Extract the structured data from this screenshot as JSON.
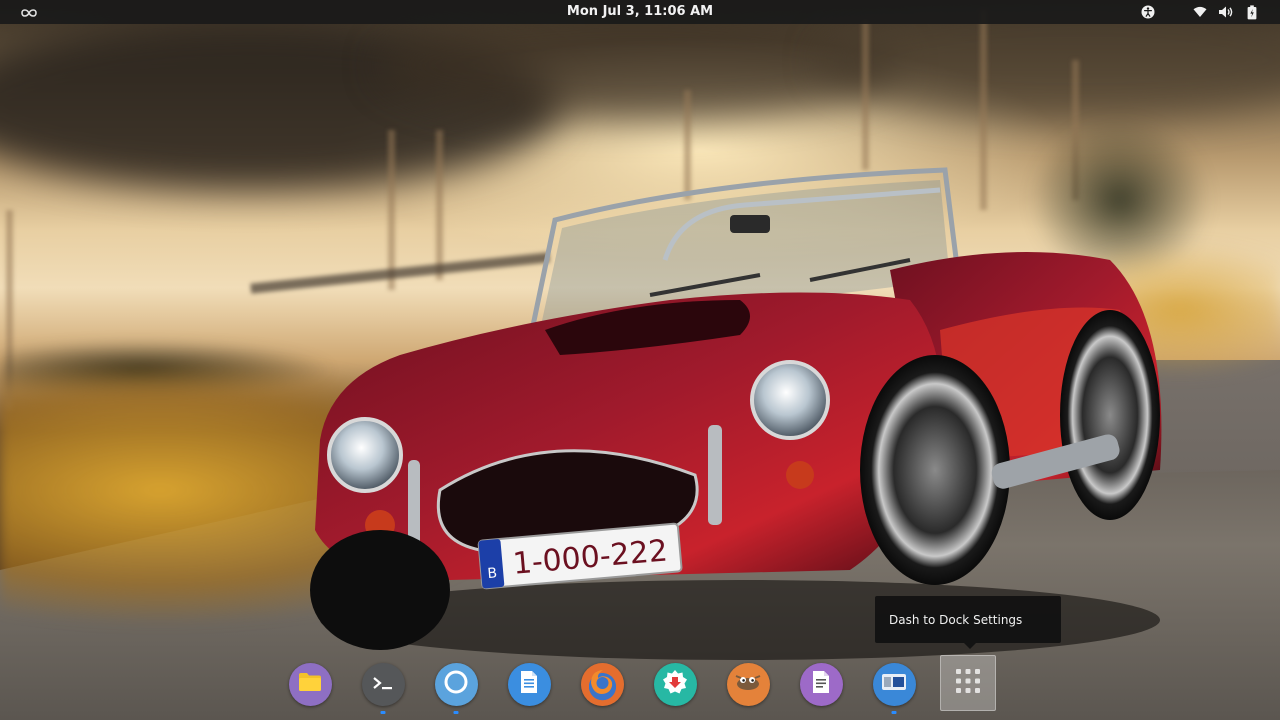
{
  "topbar": {
    "clock": "Mon Jul  3, 11:06 AM",
    "activities_icon": "infinity-icon",
    "tray_icons": [
      "accessibility-icon",
      "wifi-icon",
      "volume-icon",
      "battery-icon"
    ]
  },
  "tooltip": {
    "text": "Dash to Dock Settings"
  },
  "wallpaper": {
    "license_plate": "1-000-222",
    "plate_country": "B"
  },
  "dock": {
    "items": [
      {
        "name": "files",
        "icon": "folder-icon",
        "color": "#8e6fc3",
        "running": false
      },
      {
        "name": "terminal",
        "icon": "terminal-icon",
        "color": "#555759",
        "running": true
      },
      {
        "name": "chromium",
        "icon": "browser-icon",
        "color": "#5ba3dd",
        "running": true
      },
      {
        "name": "text-editor",
        "icon": "document-icon",
        "color": "#3b8ee0",
        "running": false
      },
      {
        "name": "firefox",
        "icon": "firefox-icon",
        "color": "#e46d2e",
        "running": false
      },
      {
        "name": "software-center",
        "icon": "software-center-icon",
        "color": "#27b8a4",
        "running": false
      },
      {
        "name": "gimp",
        "icon": "gimp-icon",
        "color": "#e4823a",
        "running": false
      },
      {
        "name": "document-viewer",
        "icon": "document-viewer-icon",
        "color": "#9d6ac8",
        "running": false
      },
      {
        "name": "system-monitor",
        "icon": "system-monitor-icon",
        "color": "#3a88d8",
        "running": true
      },
      {
        "name": "show-applications",
        "icon": "apps-grid-icon",
        "color": "#ffffff",
        "running": false
      }
    ]
  }
}
